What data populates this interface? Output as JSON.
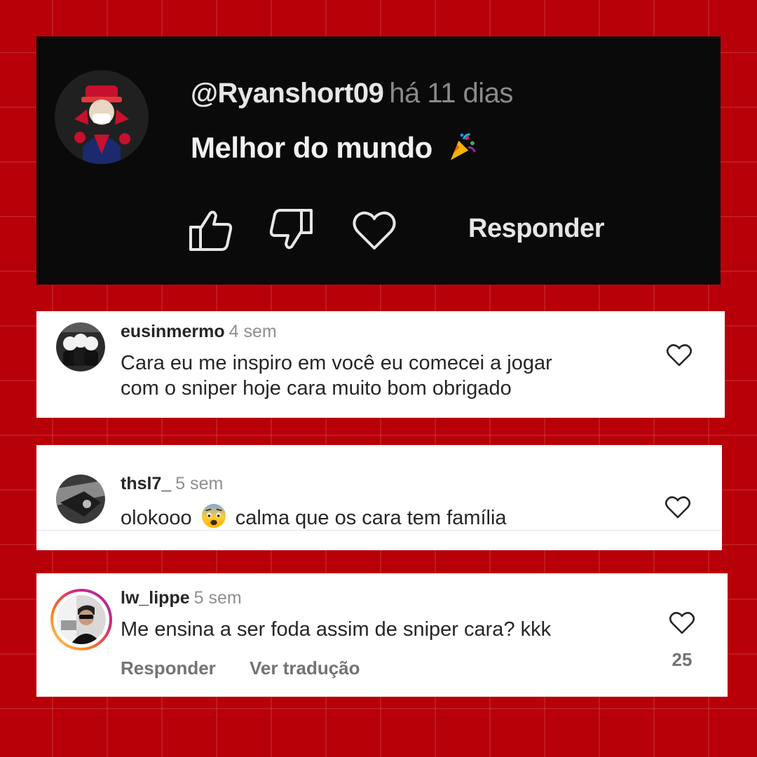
{
  "youtube_comment": {
    "username": "@Ryanshort09",
    "time": "há 11 dias",
    "text": "Melhor do mundo",
    "text_emoji": "party-popper",
    "reply_label": "Responder",
    "actions": [
      "like-icon",
      "dislike-icon",
      "heart-icon"
    ]
  },
  "instagram_comments": [
    {
      "username": "eusinmermo",
      "time": "4 sem",
      "text_lines": [
        "Cara eu me inspiro em você eu comecei a jogar",
        "com o sniper hoje cara muito bom obrigado"
      ]
    },
    {
      "username": "thsl7_",
      "time": "5 sem",
      "text_before": "olokooo",
      "text_emoji": "fearful-face",
      "text_after": "calma que os cara tem família"
    },
    {
      "username": "lw_lippe",
      "time": "5 sem",
      "text": "Me ensina a ser foda assim de sniper cara? kkk",
      "likes": "25",
      "reply_label": "Responder",
      "translate_label": "Ver tradução",
      "has_story_ring": true
    }
  ],
  "colors": {
    "background": "#b80009",
    "youtube_card": "#0a0a0a",
    "instagram_card": "#ffffff",
    "story_ring_start": "#feda75",
    "story_ring_end": "#d62976"
  }
}
